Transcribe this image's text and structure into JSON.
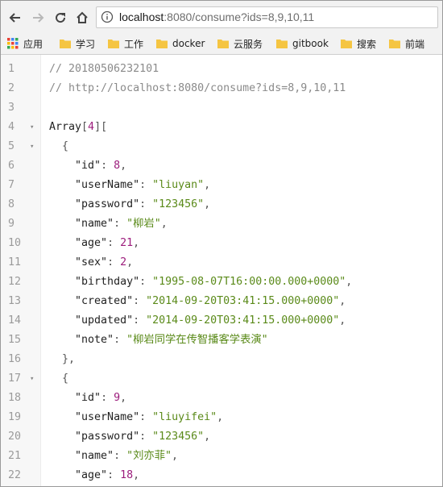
{
  "browser": {
    "url_host": "localhost",
    "url_rest": ":8080/consume?ids=8,9,10,11",
    "bookmarks": [
      "应用",
      "学习",
      "工作",
      "docker",
      "云服务",
      "gitbook",
      "搜索",
      "前端"
    ]
  },
  "colors": {
    "string": "#5a8a19",
    "number": "#9c1c7c",
    "comment": "#8a8a8a",
    "folder": "#f5c542"
  },
  "lines": [
    {
      "n": "1",
      "fold": "",
      "t": [
        [
          "c",
          "// 20180506232101"
        ]
      ]
    },
    {
      "n": "2",
      "fold": "",
      "t": [
        [
          "c",
          "// http://localhost:8080/consume?ids=8,9,10,11"
        ]
      ]
    },
    {
      "n": "3",
      "fold": "",
      "t": []
    },
    {
      "n": "4",
      "fold": "▾",
      "t": [
        [
          "k",
          "Array"
        ],
        [
          "p",
          "["
        ],
        [
          "n",
          "4"
        ],
        [
          "p",
          "]["
        ]
      ]
    },
    {
      "n": "5",
      "fold": "▾",
      "t": [
        [
          "p",
          "  {"
        ]
      ]
    },
    {
      "n": "6",
      "fold": "",
      "t": [
        [
          "p",
          "    "
        ],
        [
          "k",
          "\"id\""
        ],
        [
          "p",
          ": "
        ],
        [
          "n",
          "8"
        ],
        [
          "p",
          ","
        ]
      ]
    },
    {
      "n": "7",
      "fold": "",
      "t": [
        [
          "p",
          "    "
        ],
        [
          "k",
          "\"userName\""
        ],
        [
          "p",
          ": "
        ],
        [
          "s",
          "\"liuyan\""
        ],
        [
          "p",
          ","
        ]
      ]
    },
    {
      "n": "8",
      "fold": "",
      "t": [
        [
          "p",
          "    "
        ],
        [
          "k",
          "\"password\""
        ],
        [
          "p",
          ": "
        ],
        [
          "s",
          "\"123456\""
        ],
        [
          "p",
          ","
        ]
      ]
    },
    {
      "n": "9",
      "fold": "",
      "t": [
        [
          "p",
          "    "
        ],
        [
          "k",
          "\"name\""
        ],
        [
          "p",
          ": "
        ],
        [
          "s",
          "\"柳岩\""
        ],
        [
          "p",
          ","
        ]
      ]
    },
    {
      "n": "10",
      "fold": "",
      "t": [
        [
          "p",
          "    "
        ],
        [
          "k",
          "\"age\""
        ],
        [
          "p",
          ": "
        ],
        [
          "n",
          "21"
        ],
        [
          "p",
          ","
        ]
      ]
    },
    {
      "n": "11",
      "fold": "",
      "t": [
        [
          "p",
          "    "
        ],
        [
          "k",
          "\"sex\""
        ],
        [
          "p",
          ": "
        ],
        [
          "n",
          "2"
        ],
        [
          "p",
          ","
        ]
      ]
    },
    {
      "n": "12",
      "fold": "",
      "t": [
        [
          "p",
          "    "
        ],
        [
          "k",
          "\"birthday\""
        ],
        [
          "p",
          ": "
        ],
        [
          "s",
          "\"1995-08-07T16:00:00.000+0000\""
        ],
        [
          "p",
          ","
        ]
      ]
    },
    {
      "n": "13",
      "fold": "",
      "t": [
        [
          "p",
          "    "
        ],
        [
          "k",
          "\"created\""
        ],
        [
          "p",
          ": "
        ],
        [
          "s",
          "\"2014-09-20T03:41:15.000+0000\""
        ],
        [
          "p",
          ","
        ]
      ]
    },
    {
      "n": "14",
      "fold": "",
      "t": [
        [
          "p",
          "    "
        ],
        [
          "k",
          "\"updated\""
        ],
        [
          "p",
          ": "
        ],
        [
          "s",
          "\"2014-09-20T03:41:15.000+0000\""
        ],
        [
          "p",
          ","
        ]
      ]
    },
    {
      "n": "15",
      "fold": "",
      "t": [
        [
          "p",
          "    "
        ],
        [
          "k",
          "\"note\""
        ],
        [
          "p",
          ": "
        ],
        [
          "s",
          "\"柳岩同学在传智播客学表演\""
        ]
      ]
    },
    {
      "n": "16",
      "fold": "",
      "t": [
        [
          "p",
          "  },"
        ]
      ]
    },
    {
      "n": "17",
      "fold": "▾",
      "t": [
        [
          "p",
          "  {"
        ]
      ]
    },
    {
      "n": "18",
      "fold": "",
      "t": [
        [
          "p",
          "    "
        ],
        [
          "k",
          "\"id\""
        ],
        [
          "p",
          ": "
        ],
        [
          "n",
          "9"
        ],
        [
          "p",
          ","
        ]
      ]
    },
    {
      "n": "19",
      "fold": "",
      "t": [
        [
          "p",
          "    "
        ],
        [
          "k",
          "\"userName\""
        ],
        [
          "p",
          ": "
        ],
        [
          "s",
          "\"liuyifei\""
        ],
        [
          "p",
          ","
        ]
      ]
    },
    {
      "n": "20",
      "fold": "",
      "t": [
        [
          "p",
          "    "
        ],
        [
          "k",
          "\"password\""
        ],
        [
          "p",
          ": "
        ],
        [
          "s",
          "\"123456\""
        ],
        [
          "p",
          ","
        ]
      ]
    },
    {
      "n": "21",
      "fold": "",
      "t": [
        [
          "p",
          "    "
        ],
        [
          "k",
          "\"name\""
        ],
        [
          "p",
          ": "
        ],
        [
          "s",
          "\"刘亦菲\""
        ],
        [
          "p",
          ","
        ]
      ]
    },
    {
      "n": "22",
      "fold": "",
      "t": [
        [
          "p",
          "    "
        ],
        [
          "k",
          "\"age\""
        ],
        [
          "p",
          ": "
        ],
        [
          "n",
          "18"
        ],
        [
          "p",
          ","
        ]
      ]
    }
  ]
}
